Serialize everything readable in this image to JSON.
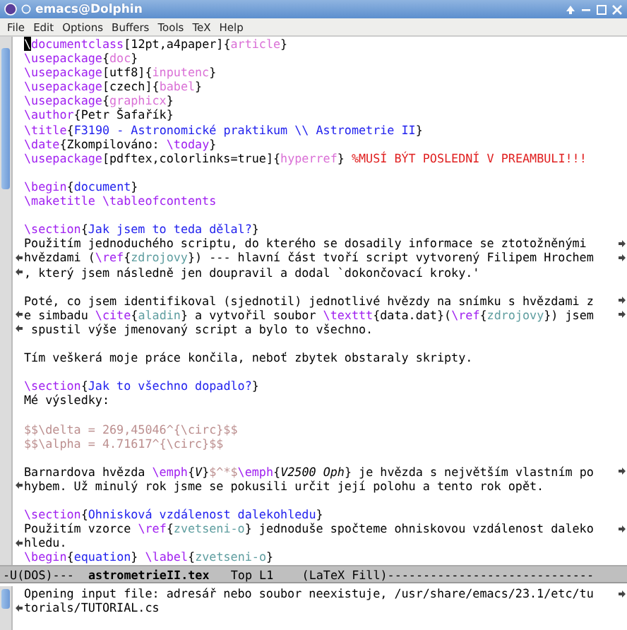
{
  "window": {
    "title": "emacs@Dolphin"
  },
  "menu": [
    "File",
    "Edit",
    "Options",
    "Buffers",
    "Tools",
    "TeX",
    "Help"
  ],
  "lines": [
    {
      "continues": false,
      "wraps": false,
      "segments": [
        {
          "text": "\\",
          "kind": "cursor"
        },
        {
          "text": "documentclass",
          "kind": "command"
        },
        {
          "text": "[12pt,a4paper]{",
          "kind": "text"
        },
        {
          "text": "article",
          "kind": "argument"
        },
        {
          "text": "}",
          "kind": "text"
        }
      ]
    },
    {
      "continues": false,
      "wraps": false,
      "segments": [
        {
          "text": "\\usepackage",
          "kind": "command"
        },
        {
          "text": "{",
          "kind": "text"
        },
        {
          "text": "doc",
          "kind": "argument"
        },
        {
          "text": "}",
          "kind": "text"
        }
      ]
    },
    {
      "continues": false,
      "wraps": false,
      "segments": [
        {
          "text": "\\usepackage",
          "kind": "command"
        },
        {
          "text": "[utf8]{",
          "kind": "text"
        },
        {
          "text": "inputenc",
          "kind": "argument"
        },
        {
          "text": "}",
          "kind": "text"
        }
      ]
    },
    {
      "continues": false,
      "wraps": false,
      "segments": [
        {
          "text": "\\usepackage",
          "kind": "command"
        },
        {
          "text": "[czech]{",
          "kind": "text"
        },
        {
          "text": "babel",
          "kind": "argument"
        },
        {
          "text": "}",
          "kind": "text"
        }
      ]
    },
    {
      "continues": false,
      "wraps": false,
      "segments": [
        {
          "text": "\\usepackage",
          "kind": "command"
        },
        {
          "text": "{",
          "kind": "text"
        },
        {
          "text": "graphicx",
          "kind": "argument"
        },
        {
          "text": "}",
          "kind": "text"
        }
      ]
    },
    {
      "continues": false,
      "wraps": false,
      "segments": [
        {
          "text": "\\author",
          "kind": "command"
        },
        {
          "text": "{Petr Šafařík}",
          "kind": "text"
        }
      ]
    },
    {
      "continues": false,
      "wraps": false,
      "segments": [
        {
          "text": "\\title",
          "kind": "command"
        },
        {
          "text": "{",
          "kind": "text"
        },
        {
          "text": "F3190 - Astronomické praktikum \\\\ Astrometrie II",
          "kind": "heading"
        },
        {
          "text": "}",
          "kind": "text"
        }
      ]
    },
    {
      "continues": false,
      "wraps": false,
      "segments": [
        {
          "text": "\\date",
          "kind": "command"
        },
        {
          "text": "{Zkompilováno: ",
          "kind": "text"
        },
        {
          "text": "\\today",
          "kind": "command"
        },
        {
          "text": "}",
          "kind": "text"
        }
      ]
    },
    {
      "continues": false,
      "wraps": false,
      "segments": [
        {
          "text": "\\usepackage",
          "kind": "command"
        },
        {
          "text": "[pdftex,colorlinks=true]{",
          "kind": "text"
        },
        {
          "text": "hyperref",
          "kind": "argument"
        },
        {
          "text": "} ",
          "kind": "text"
        },
        {
          "text": "%MUSÍ BÝT POSLEDNÍ V PREAMBULI!!!",
          "kind": "comment"
        }
      ]
    },
    {
      "continues": false,
      "wraps": false
    },
    {
      "continues": false,
      "wraps": false,
      "segments": [
        {
          "text": "\\begin",
          "kind": "command"
        },
        {
          "text": "{",
          "kind": "text"
        },
        {
          "text": "document",
          "kind": "heading"
        },
        {
          "text": "}",
          "kind": "text"
        }
      ]
    },
    {
      "continues": false,
      "wraps": false,
      "segments": [
        {
          "text": "\\maketitle \\tableofcontents",
          "kind": "command"
        }
      ]
    },
    {
      "continues": false,
      "wraps": false
    },
    {
      "continues": false,
      "wraps": false,
      "segments": [
        {
          "text": "\\section",
          "kind": "command"
        },
        {
          "text": "{",
          "kind": "text"
        },
        {
          "text": "Jak jsem to teda dělal?",
          "kind": "heading"
        },
        {
          "text": "}",
          "kind": "text"
        }
      ]
    },
    {
      "continues": false,
      "wraps": true,
      "segments": [
        {
          "text": "Použitím jednoduchého scriptu, do kterého se dosadily informace se ztotožněnými ",
          "kind": "text"
        }
      ]
    },
    {
      "continues": true,
      "wraps": true,
      "segments": [
        {
          "text": "hvězdami (",
          "kind": "text"
        },
        {
          "text": "\\ref",
          "kind": "command"
        },
        {
          "text": "{",
          "kind": "text"
        },
        {
          "text": "zdrojovy",
          "kind": "reference"
        },
        {
          "text": "}) --- hlavní část tvoří script vytvorený Filipem Hrochem",
          "kind": "text"
        }
      ]
    },
    {
      "continues": true,
      "wraps": false,
      "segments": [
        {
          "text": ", který jsem následně jen doupravil a dodal `dokončovací kroky.'",
          "kind": "text"
        }
      ]
    },
    {
      "continues": false,
      "wraps": false
    },
    {
      "continues": false,
      "wraps": true,
      "segments": [
        {
          "text": "Poté, co jsem identifikoval (sjednotil) jednotlivé hvězdy na snímku s hvězdami z",
          "kind": "text"
        }
      ]
    },
    {
      "continues": true,
      "wraps": true,
      "segments": [
        {
          "text": "e simbadu ",
          "kind": "text"
        },
        {
          "text": "\\cite",
          "kind": "command"
        },
        {
          "text": "{",
          "kind": "text"
        },
        {
          "text": "aladin",
          "kind": "reference"
        },
        {
          "text": "} a vytvořil soubor ",
          "kind": "text"
        },
        {
          "text": "\\texttt",
          "kind": "command"
        },
        {
          "text": "{data.dat}(",
          "kind": "text"
        },
        {
          "text": "\\ref",
          "kind": "command"
        },
        {
          "text": "{",
          "kind": "text"
        },
        {
          "text": "zdrojovy",
          "kind": "reference"
        },
        {
          "text": "}) jsem",
          "kind": "text"
        }
      ]
    },
    {
      "continues": true,
      "wraps": false,
      "segments": [
        {
          "text": " spustil výše jmenovaný script a bylo to všechno.",
          "kind": "text"
        }
      ]
    },
    {
      "continues": false,
      "wraps": false
    },
    {
      "continues": false,
      "wraps": false,
      "segments": [
        {
          "text": "Tím veškerá moje práce končila, neboť zbytek obstaraly skripty.",
          "kind": "text"
        }
      ]
    },
    {
      "continues": false,
      "wraps": false
    },
    {
      "continues": false,
      "wraps": false,
      "segments": [
        {
          "text": "\\section",
          "kind": "command"
        },
        {
          "text": "{",
          "kind": "text"
        },
        {
          "text": "Jak to všechno dopadlo?",
          "kind": "heading"
        },
        {
          "text": "}",
          "kind": "text"
        }
      ]
    },
    {
      "continues": false,
      "wraps": false,
      "segments": [
        {
          "text": "Mé výsledky:",
          "kind": "text"
        }
      ]
    },
    {
      "continues": false,
      "wraps": false
    },
    {
      "continues": false,
      "wraps": false,
      "segments": [
        {
          "text": "$$\\delta = 269,45046^{\\circ}$$",
          "kind": "math"
        }
      ]
    },
    {
      "continues": false,
      "wraps": false,
      "segments": [
        {
          "text": "$$\\alpha = 4.71617^{\\circ}$$",
          "kind": "math"
        }
      ]
    },
    {
      "continues": false,
      "wraps": false
    },
    {
      "continues": false,
      "wraps": true,
      "segments": [
        {
          "text": "Barnardova hvězda ",
          "kind": "text"
        },
        {
          "text": "\\emph",
          "kind": "command"
        },
        {
          "text": "{",
          "kind": "text"
        },
        {
          "text": "V",
          "kind": "emphasis"
        },
        {
          "text": "}",
          "kind": "text"
        },
        {
          "text": "$^*$",
          "kind": "math"
        },
        {
          "text": "\\emph",
          "kind": "command"
        },
        {
          "text": "{",
          "kind": "text"
        },
        {
          "text": "V2500 Oph",
          "kind": "emphasis"
        },
        {
          "text": "} je hvězda s největším vlastním po",
          "kind": "text"
        }
      ]
    },
    {
      "continues": true,
      "wraps": false,
      "segments": [
        {
          "text": "hybem. Už minulý rok jsme se pokusili určit její polohu a tento rok opět.",
          "kind": "text"
        }
      ]
    },
    {
      "continues": false,
      "wraps": false
    },
    {
      "continues": false,
      "wraps": false,
      "segments": [
        {
          "text": "\\section",
          "kind": "command"
        },
        {
          "text": "{",
          "kind": "text"
        },
        {
          "text": "Ohnisková vzdálenost dalekohledu",
          "kind": "heading"
        },
        {
          "text": "}",
          "kind": "text"
        }
      ]
    },
    {
      "continues": false,
      "wraps": true,
      "segments": [
        {
          "text": "Použitím vzorce ",
          "kind": "text"
        },
        {
          "text": "\\ref",
          "kind": "command"
        },
        {
          "text": "{",
          "kind": "text"
        },
        {
          "text": "zvetseni-o",
          "kind": "reference"
        },
        {
          "text": "} jednoduše spočteme ohniskovou vzdálenost daleko",
          "kind": "text"
        }
      ]
    },
    {
      "continues": true,
      "wraps": false,
      "segments": [
        {
          "text": "hledu.",
          "kind": "text"
        }
      ]
    },
    {
      "continues": false,
      "wraps": false,
      "segments": [
        {
          "text": "\\begin",
          "kind": "command"
        },
        {
          "text": "{",
          "kind": "text"
        },
        {
          "text": "equation",
          "kind": "heading"
        },
        {
          "text": "} ",
          "kind": "text"
        },
        {
          "text": "\\label",
          "kind": "command"
        },
        {
          "text": "{",
          "kind": "text"
        },
        {
          "text": "zvetseni-o",
          "kind": "reference"
        },
        {
          "text": "}",
          "kind": "text"
        }
      ]
    }
  ],
  "mode_line": [
    {
      "text": "-U(DOS)---  ",
      "kind": "text"
    },
    {
      "text": "astrometrieII.tex",
      "kind": "buffer"
    },
    {
      "text": "   Top L1    (LaTeX Fill)-----------------------------",
      "kind": "text"
    }
  ],
  "echo_area": [
    {
      "continues": false,
      "wraps": true,
      "text": "Opening input file: adresář nebo soubor neexistuje, /usr/share/emacs/23.1/etc/tu"
    },
    {
      "continues": true,
      "wraps": false,
      "text": "torials/TUTORIAL.cs"
    }
  ]
}
